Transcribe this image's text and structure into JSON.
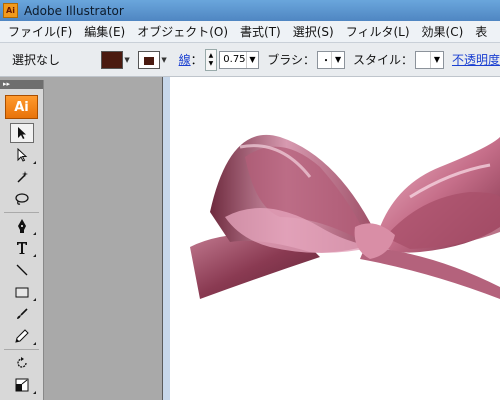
{
  "window": {
    "app_icon_text": "Ai",
    "title": "Adobe Illustrator"
  },
  "menu": [
    {
      "label": "ファイル(F)"
    },
    {
      "label": "編集(E)"
    },
    {
      "label": "オブジェクト(O)"
    },
    {
      "label": "書式(T)"
    },
    {
      "label": "選択(S)"
    },
    {
      "label": "フィルタ(L)"
    },
    {
      "label": "効果(C)"
    },
    {
      "label": "表"
    }
  ],
  "control_bar": {
    "selection_status": "選択なし",
    "fill_color": "#4a1a10",
    "stroke_color": "#4a1a10",
    "stroke_label": "線",
    "stroke_weight": "0.75",
    "brush_label": "ブラシ：",
    "brush_value": "・",
    "style_label": "スタイル：",
    "opacity_label": "不透明度"
  },
  "toolbox": {
    "logo_text": "Ai",
    "tools": [
      {
        "name": "selection-tool",
        "glyph": "arrow-black",
        "active": true
      },
      {
        "name": "direct-selection-tool",
        "glyph": "arrow-white"
      },
      {
        "name": "magic-wand-tool",
        "glyph": "wand"
      },
      {
        "name": "lasso-tool",
        "glyph": "lasso"
      },
      {
        "name": "pen-tool",
        "glyph": "pen"
      },
      {
        "name": "type-tool",
        "glyph": "T"
      },
      {
        "name": "line-tool",
        "glyph": "line"
      },
      {
        "name": "rectangle-tool",
        "glyph": "rect"
      },
      {
        "name": "paintbrush-tool",
        "glyph": "brush"
      },
      {
        "name": "pencil-tool",
        "glyph": "pencil"
      },
      {
        "name": "rotate-tool",
        "glyph": "rotate"
      },
      {
        "name": "scale-tool",
        "glyph": "scale"
      }
    ]
  },
  "colors": {
    "ribbon_dark": "#7a2f45",
    "ribbon_mid": "#b0627a",
    "ribbon_light": "#e7a8bd"
  }
}
